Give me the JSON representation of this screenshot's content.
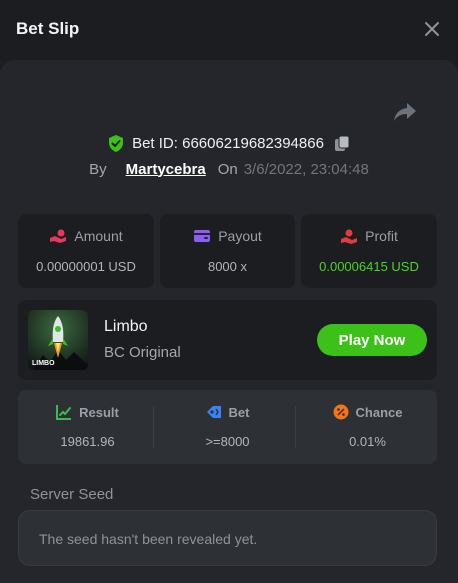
{
  "header": {
    "title": "Bet Slip"
  },
  "bet": {
    "id_label": "Bet ID: 66606219682394866",
    "by_label": "By",
    "user": "Martycebra",
    "on_label": "On",
    "time": "3/6/2022, 23:04:48"
  },
  "stats": [
    {
      "label": "Amount",
      "value": "0.00000001 USD"
    },
    {
      "label": "Payout",
      "value": "8000 x"
    },
    {
      "label": "Profit",
      "value": "0.00006415 USD"
    }
  ],
  "game": {
    "name": "Limbo",
    "sub": "BC Original",
    "play_label": "Play Now",
    "thumb_text": "LIMBO"
  },
  "results": [
    {
      "label": "Result",
      "value": "19861.96"
    },
    {
      "label": "Bet",
      "value": ">=8000"
    },
    {
      "label": "Chance",
      "value": "0.01%"
    }
  ],
  "seed": {
    "label": "Server Seed",
    "text": "The seed hasn't been revealed yet."
  },
  "colors": {
    "accent_green": "#3bc117",
    "profit_green": "#4ad523",
    "amount_pink": "#e8365c",
    "payout_purple": "#8b5cf6",
    "profit_red": "#e33b3b",
    "result_green": "#3fb950",
    "bet_blue": "#3b82f6",
    "chance_orange": "#f97316"
  }
}
